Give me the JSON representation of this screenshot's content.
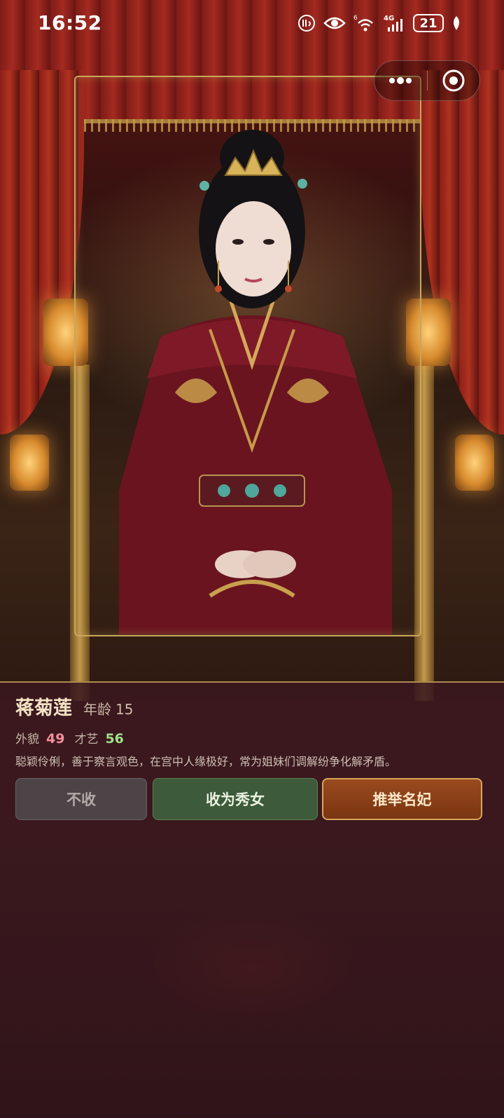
{
  "status_bar": {
    "time": "16:52",
    "icons": [
      "hd-icon",
      "eye-icon",
      "wifi-icon",
      "signal-4g-icon",
      "battery-icon",
      "leaf-icon"
    ],
    "battery_level": "21",
    "wifi_badge": "6",
    "network_label": "4G"
  },
  "capsule": {
    "more_icon": "more-dots-icon",
    "close_icon": "target-circle-icon"
  },
  "candidate": {
    "name": "蒋菊莲",
    "age_label": "年龄",
    "age_value": "15",
    "looks_label": "外貌",
    "looks_value": "49",
    "talent_label": "才艺",
    "talent_value": "56",
    "description": "聪颖伶俐，善于察言观色，在宫中人缘极好，常为姐妹们调解纷争化解矛盾。"
  },
  "actions": {
    "reject_label": "不收",
    "accept_label": "收为秀女",
    "recommend_label": "推举名妃"
  },
  "colors": {
    "panel_bg": "#3a181e",
    "gold_border": "#c9a65b",
    "looks_color": "#f28f9b",
    "talent_color": "#9ee08a",
    "reject_bg": "#4c4447",
    "accept_bg": "#3d5a3a",
    "recommend_bg": "#8a4018"
  }
}
